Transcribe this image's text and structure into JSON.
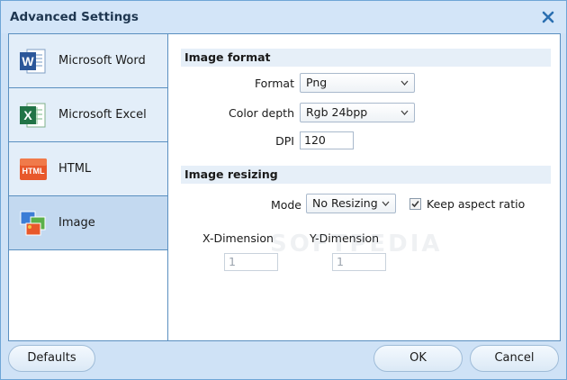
{
  "window": {
    "title": "Advanced Settings"
  },
  "sidebar": {
    "items": [
      {
        "label": "Microsoft Word",
        "icon": "word-icon"
      },
      {
        "label": "Microsoft Excel",
        "icon": "excel-icon"
      },
      {
        "label": "HTML",
        "icon": "html-icon",
        "icon_text": "HTML"
      },
      {
        "label": "Image",
        "icon": "image-icon",
        "active": true
      }
    ]
  },
  "image_format": {
    "heading": "Image format",
    "format_label": "Format",
    "format_value": "Png",
    "color_depth_label": "Color depth",
    "color_depth_value": "Rgb 24bpp",
    "dpi_label": "DPI",
    "dpi_value": "120"
  },
  "image_resizing": {
    "heading": "Image resizing",
    "mode_label": "Mode",
    "mode_value": "No Resizing",
    "keep_aspect_label": "Keep aspect ratio",
    "keep_aspect_checked": true,
    "x_label": "X-Dimension",
    "x_value": "1",
    "y_label": "Y-Dimension",
    "y_value": "1"
  },
  "footer": {
    "defaults_label": "Defaults",
    "ok_label": "OK",
    "cancel_label": "Cancel"
  },
  "watermark": "SOFTPEDIA",
  "colors": {
    "accent": "#5a8fc0",
    "title_text": "#1e3650",
    "close_icon": "#2a6fb0",
    "active_item": "#c3d9f0"
  }
}
